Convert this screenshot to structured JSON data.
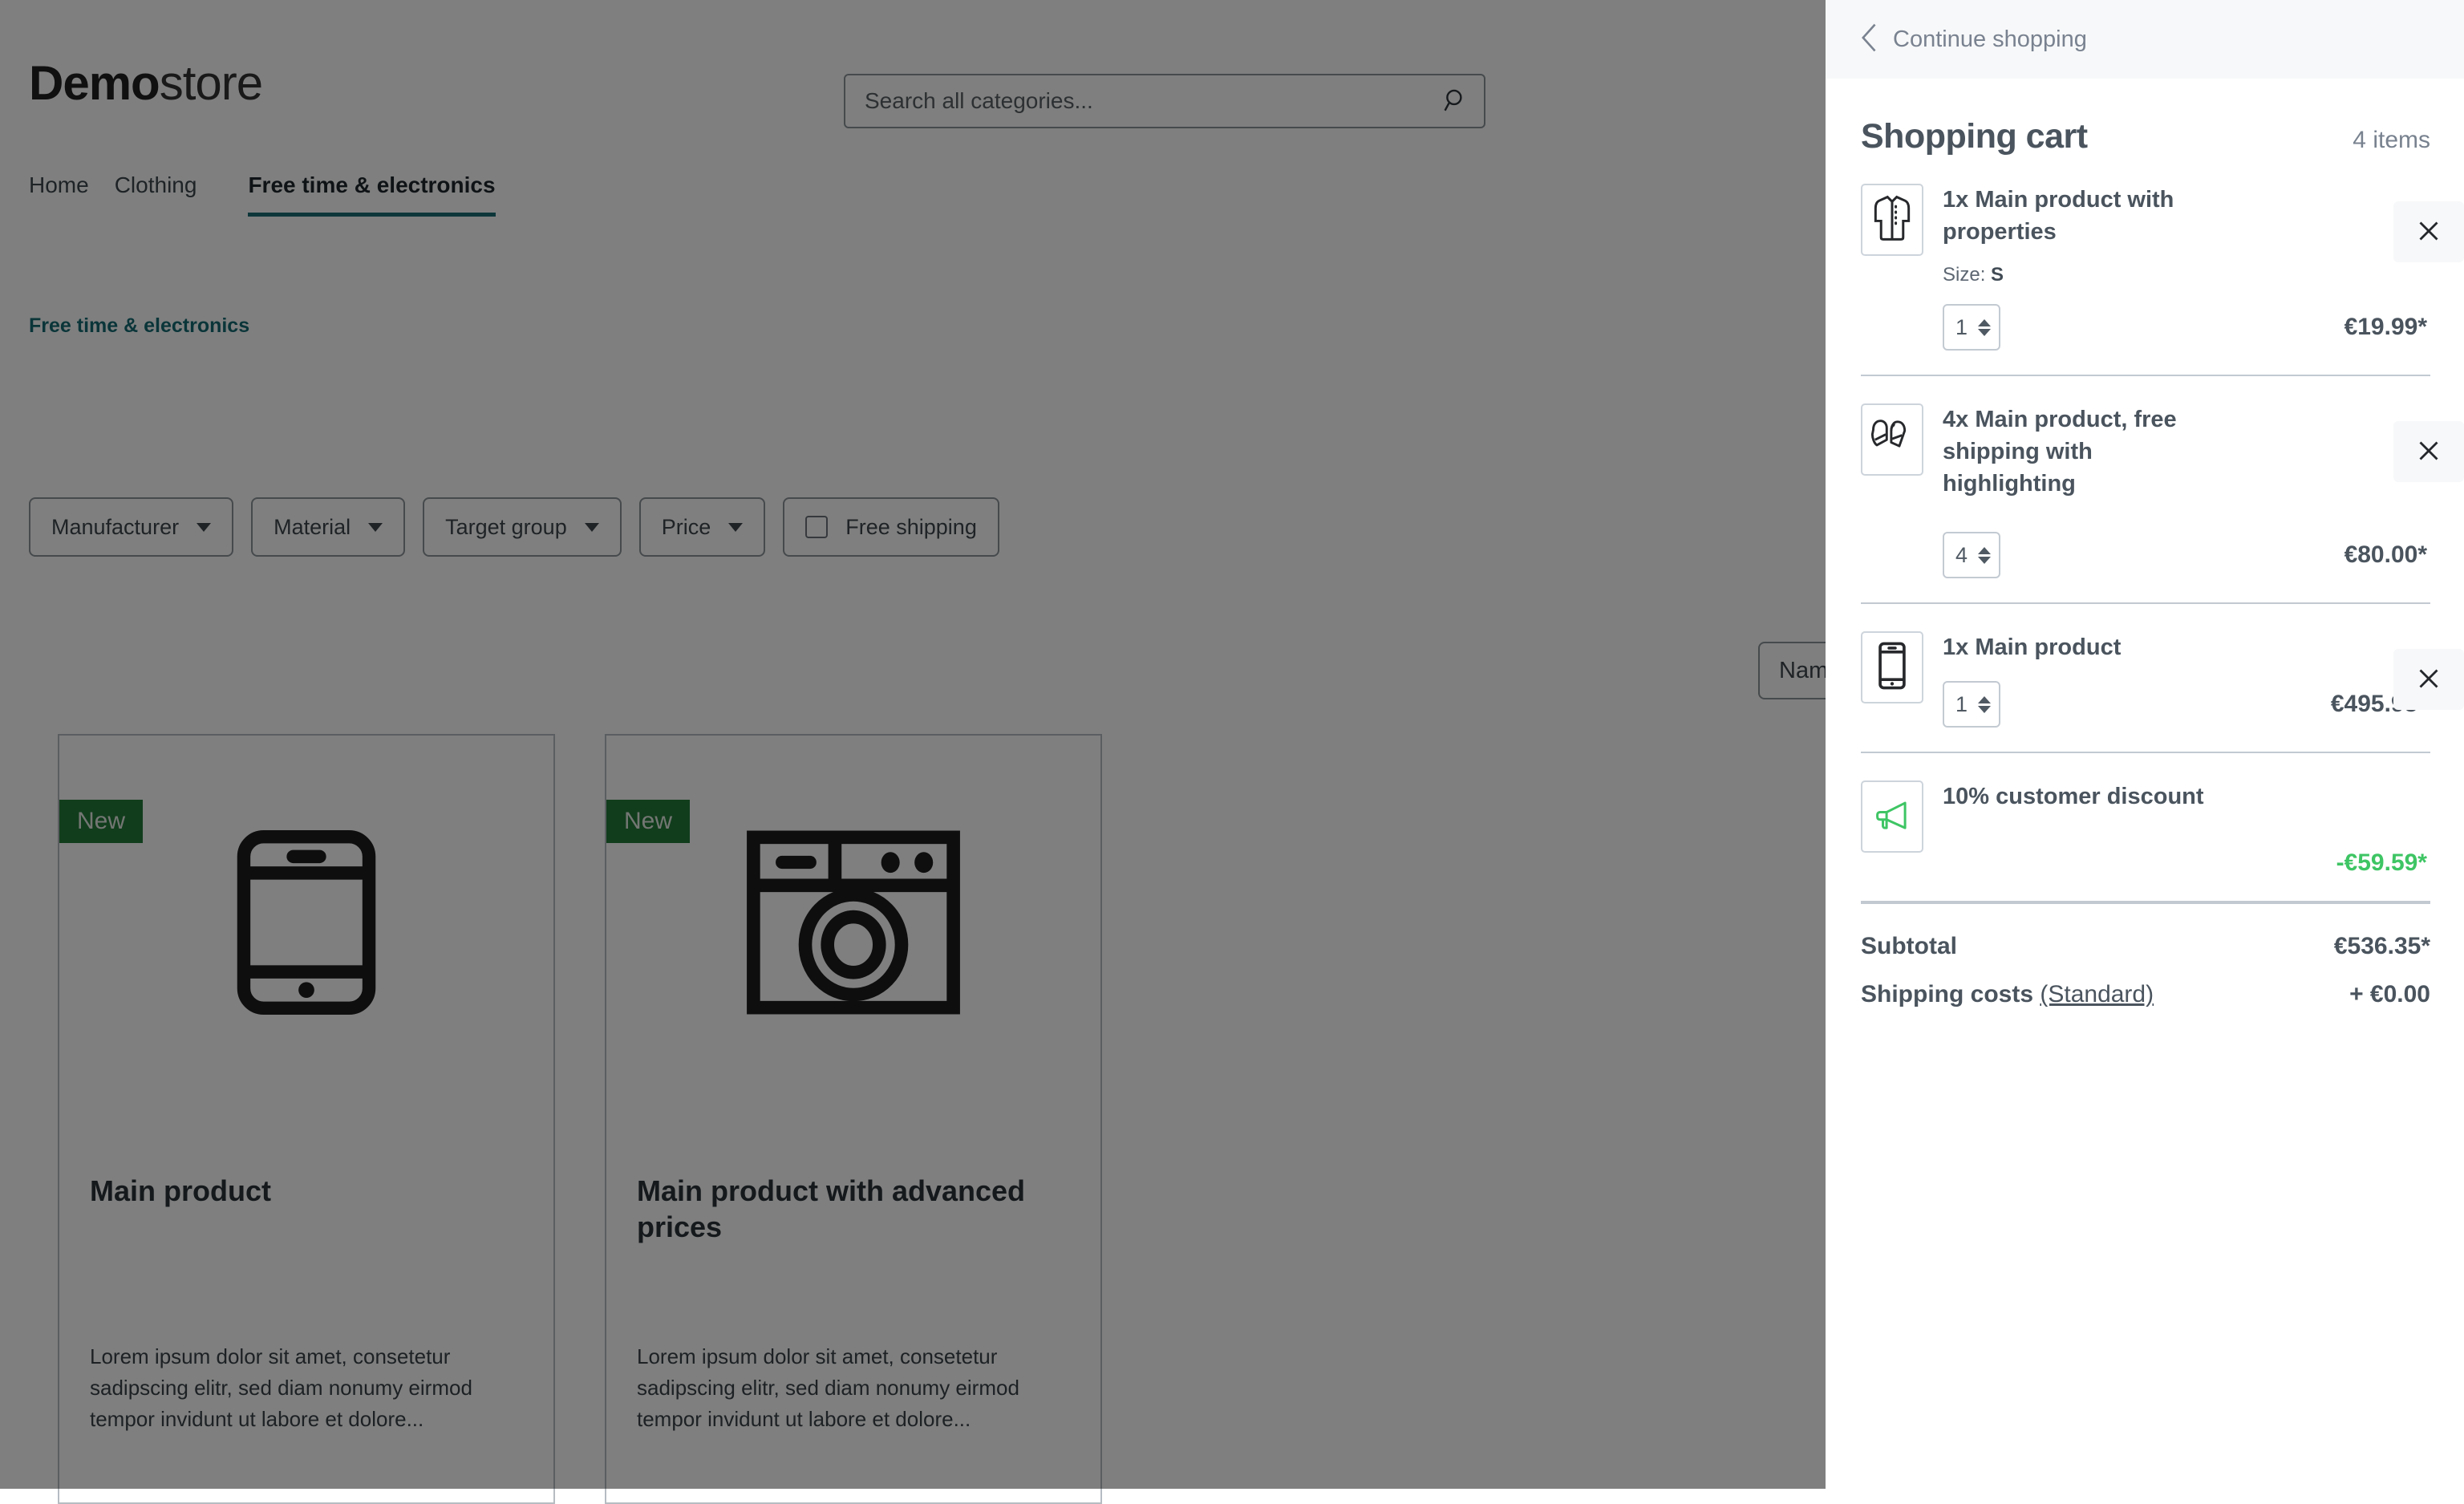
{
  "shop": {
    "logo": {
      "bold": "Demo",
      "light": "store"
    },
    "search": {
      "placeholder": "Search all categories...",
      "value": "",
      "icon": "search-icon"
    },
    "nav": [
      {
        "label": "Home",
        "active": false
      },
      {
        "label": "Clothing",
        "active": false
      },
      {
        "label": "Free time & electronics",
        "active": true
      }
    ],
    "breadcrumb": "Free time & electronics",
    "accent_color": "#156a72",
    "filters": [
      {
        "label": "Manufacturer",
        "type": "dropdown"
      },
      {
        "label": "Material",
        "type": "dropdown"
      },
      {
        "label": "Target group",
        "type": "dropdown"
      },
      {
        "label": "Price",
        "type": "dropdown"
      },
      {
        "label": "Free shipping",
        "type": "checkbox",
        "checked": false
      }
    ],
    "sorting": {
      "value": "Nam"
    },
    "products": [
      {
        "badge": "New",
        "badge_color": "#227b38",
        "icon": "smartphone-icon",
        "title": "Main product",
        "description": "Lorem ipsum dolor sit amet, consetetur sadipscing elitr, sed diam nonumy eirmod tempor invidunt ut labore et dolore..."
      },
      {
        "badge": "New",
        "badge_color": "#227b38",
        "icon": "washing-machine-icon",
        "title": "Main product with advanced prices",
        "description": "Lorem ipsum dolor sit amet, consetetur sadipscing elitr, sed diam nonumy eirmod tempor invidunt ut labore et dolore..."
      }
    ]
  },
  "cart": {
    "back_label": "Continue shopping",
    "back_icon": "chevron-left-icon",
    "title": "Shopping cart",
    "count_label": "4 items",
    "remove_icon": "close-icon",
    "discount_color": "#3ec564",
    "items": [
      {
        "icon": "jacket-icon",
        "name": "1x Main product with properties",
        "property_label": "Size:",
        "property_value": "S",
        "quantity": "1",
        "price": "€19.99*",
        "is_discount": false,
        "has_quantity": true,
        "has_remove": true
      },
      {
        "icon": "mittens-icon",
        "name": "4x Main product, free shipping with highlighting",
        "property_label": "",
        "property_value": "",
        "quantity": "4",
        "price": "€80.00*",
        "is_discount": false,
        "has_quantity": true,
        "has_remove": true
      },
      {
        "icon": "smartphone-icon",
        "name": "1x Main product",
        "property_label": "",
        "property_value": "",
        "quantity": "1",
        "price": "€495.95*",
        "is_discount": false,
        "has_quantity": true,
        "has_remove": true
      },
      {
        "icon": "megaphone-icon",
        "name": "10% customer discount",
        "property_label": "",
        "property_value": "",
        "quantity": "",
        "price": "-€59.59*",
        "is_discount": true,
        "has_quantity": false,
        "has_remove": false
      }
    ],
    "summary": [
      {
        "label": "Subtotal",
        "sublabel": "",
        "value": "€536.35*"
      },
      {
        "label": "Shipping costs",
        "sublabel": "(Standard)",
        "value": "+ €0.00"
      }
    ]
  }
}
